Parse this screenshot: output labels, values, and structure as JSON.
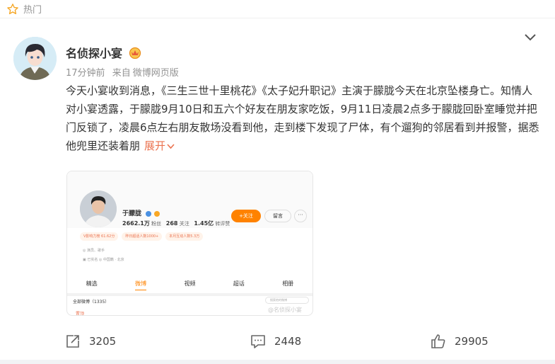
{
  "hot_bar": {
    "icon": "star-icon",
    "label": "热门"
  },
  "post": {
    "author": "名侦探小宴",
    "time": "17分钟前",
    "source_prefix": "来自",
    "source": "微博网页版",
    "text": "今天小宴收到消息，《三生三世十里桃花》《太子妃升职记》主演于朦胧今天在北京坠楼身亡。知情人对小宴透露，于朦胧9月10日和五六个好友在朋友家吃饭，9月11日凌晨2点多于朦胧回卧室睡觉并把门反锁了，凌晨6点左右朋友散场没看到他，走到楼下发现了尸体，有个遛狗的邻居看到并报警，据悉他兜里还装着朋",
    "expand_label": "展开"
  },
  "embedded_profile": {
    "name": "于朦胧",
    "followers_value": "2662.1万",
    "followers_label": "粉丝",
    "following_value": "268",
    "following_label": "关注",
    "likes_value": "1.45亿",
    "likes_label": "转评赞",
    "follow_label": "+关注",
    "message_label": "留言",
    "more_label": "···",
    "tags": [
      "V影响力榜 61.62分",
      "昨日超话人数1000+",
      "本月互动人数5.3万"
    ],
    "info1": "◎ 演员、歌手",
    "info2": "▣ 已实名   ◎ 中国籍 · 北京",
    "tabs": [
      "精选",
      "微博",
      "视频",
      "超话",
      "相册"
    ],
    "active_tab": "微博",
    "all_weibo_label": "全部微博（1335）",
    "search_placeholder": "搜索他的微博",
    "mark": "置顶",
    "watermark": "@名侦探小宴"
  },
  "actions": {
    "repost_count": "3205",
    "comment_count": "2448",
    "like_count": "29905"
  },
  "colors": {
    "accent": "#eb7350",
    "orange": "#ff8200",
    "muted": "#939393"
  }
}
